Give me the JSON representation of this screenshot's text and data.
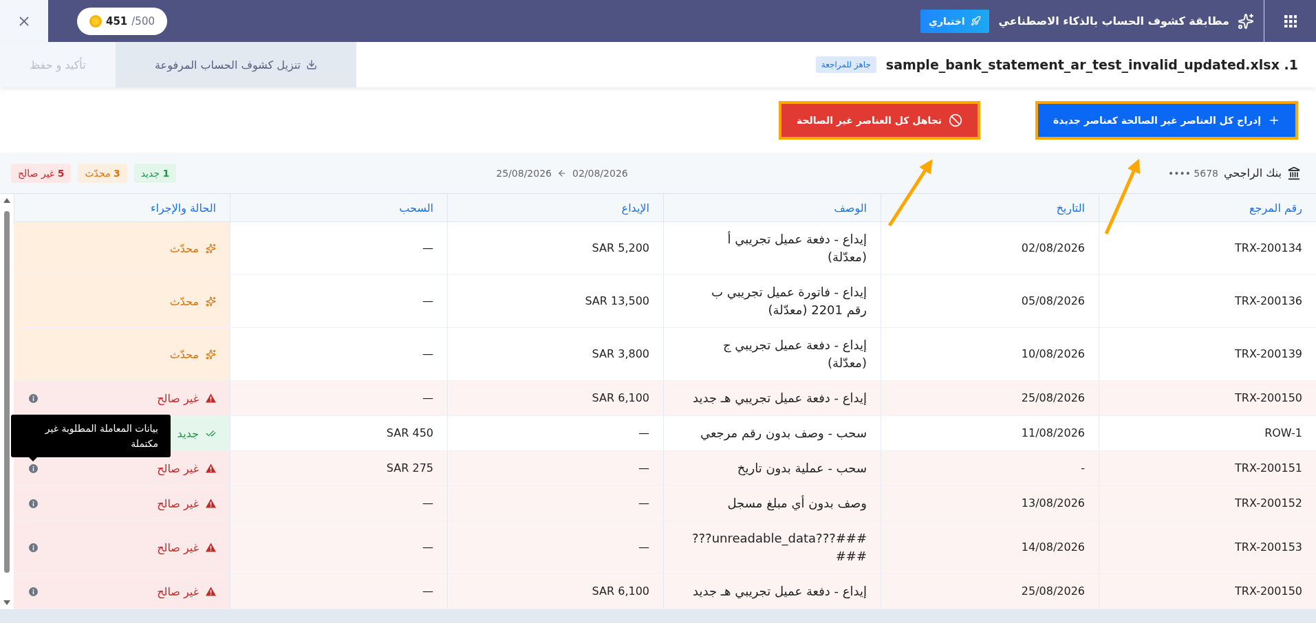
{
  "top_bar": {
    "title": "مطابقة كشوف الحساب بالذكاء الاصطناعي",
    "badge": "اختباري",
    "credits": {
      "used": "451",
      "total": "/500"
    }
  },
  "file_bar": {
    "title": "1. sample_bank_statement_ar_test_invalid_updated.xlsx",
    "status": "جاهز للمراجعة",
    "tabs": [
      {
        "label": "تنزيل كشوف الحساب المرفوعة",
        "selected": true,
        "disabled": false
      },
      {
        "label": "تأكيد و حفظ",
        "selected": false,
        "disabled": true
      }
    ]
  },
  "actions": [
    {
      "kind": "insert",
      "label": "إدراج كل العناصر غير الصالحة كعناصر جديدة"
    },
    {
      "kind": "ignore",
      "label": "تجاهل كل العناصر غير الصالحة"
    }
  ],
  "summary": {
    "bank": "بنك الراجحي",
    "account": "•••• 5678",
    "date_from": "02/08/2026",
    "date_to": "25/08/2026",
    "counts": [
      {
        "kind": "new",
        "count": "1",
        "label": "جديد"
      },
      {
        "kind": "updated",
        "count": "3",
        "label": "محدّث"
      },
      {
        "kind": "invalid",
        "count": "5",
        "label": "غير صالح"
      }
    ]
  },
  "table": {
    "columns": [
      "رقم المرجع",
      "التاريخ",
      "الوصف",
      "الإيداع",
      "السحب",
      "الحالة والإجراء"
    ],
    "rows": [
      {
        "ref": "TRX-200134",
        "date": "02/08/2026",
        "description": "إيداع - دفعة عميل تجريبي أ (معدّلة)",
        "deposit": "SAR 5,200",
        "withdrawal": "—",
        "status": {
          "kind": "updated",
          "label": "محدّث"
        }
      },
      {
        "ref": "TRX-200136",
        "date": "05/08/2026",
        "description": "إيداع - فاتورة عميل تجريبي ب رقم 2201 (معدّلة)",
        "deposit": "SAR 13,500",
        "withdrawal": "—",
        "status": {
          "kind": "updated",
          "label": "محدّث"
        }
      },
      {
        "ref": "TRX-200139",
        "date": "10/08/2026",
        "description": "إيداع - دفعة عميل تجريبي ج (معدّلة)",
        "deposit": "SAR 3,800",
        "withdrawal": "—",
        "status": {
          "kind": "updated",
          "label": "محدّث"
        }
      },
      {
        "ref": "TRX-200150",
        "date": "25/08/2026",
        "description": "إيداع - دفعة عميل تجريبي هـ جديد",
        "deposit": "SAR 6,100",
        "withdrawal": "—",
        "status": {
          "kind": "invalid",
          "label": "غير صالح"
        }
      },
      {
        "ref": "ROW-1",
        "date": "11/08/2026",
        "description": "سحب - وصف بدون رقم مرجعي",
        "deposit": "—",
        "withdrawal": "SAR 450",
        "status": {
          "kind": "new",
          "label": "جديد"
        }
      },
      {
        "ref": "TRX-200151",
        "date": "-",
        "description": "سحب - عملية بدون تاريخ",
        "deposit": "—",
        "withdrawal": "SAR 275",
        "status": {
          "kind": "invalid",
          "label": "غير صالح"
        }
      },
      {
        "ref": "TRX-200152",
        "date": "13/08/2026",
        "description": "وصف بدون أي مبلغ مسجل",
        "deposit": "—",
        "withdrawal": "—",
        "status": {
          "kind": "invalid",
          "label": "غير صالح"
        }
      },
      {
        "ref": "TRX-200153",
        "date": "14/08/2026",
        "description": "###???unreadable_data???###",
        "deposit": "—",
        "withdrawal": "—",
        "status": {
          "kind": "invalid",
          "label": "غير صالح"
        }
      },
      {
        "ref": "TRX-200150",
        "date": "25/08/2026",
        "description": "إيداع - دفعة عميل تجريبي هـ جديد",
        "deposit": "SAR 6,100",
        "withdrawal": "—",
        "status": {
          "kind": "invalid",
          "label": "غير صالح"
        }
      }
    ]
  },
  "tooltip": {
    "text": "بيانات المعاملة المطلوبة غير مكتملة"
  }
}
